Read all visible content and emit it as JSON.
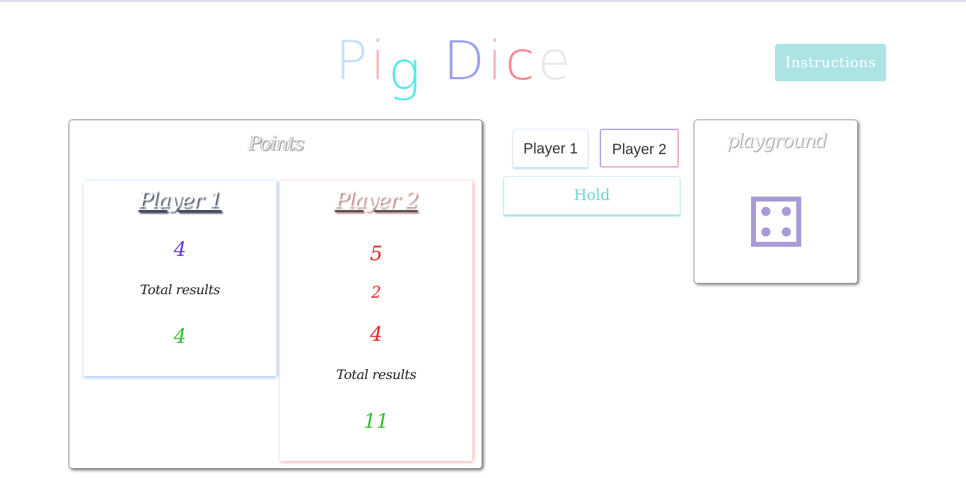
{
  "header": {
    "title_letters": [
      {
        "char": "P",
        "color": "#c6defb"
      },
      {
        "char": "i",
        "color": "#f8b9bf"
      },
      {
        "char": "g",
        "color": "#58e9ea"
      },
      {
        "char": " ",
        "color": "#ffffff"
      },
      {
        "char": "D",
        "color": "#9ba0f1"
      },
      {
        "char": "i",
        "color": "#f8b7bc"
      },
      {
        "char": "c",
        "color": "#f5898e"
      },
      {
        "char": "e",
        "color": "#e5e9ec"
      }
    ],
    "instructions_label": "Instructions"
  },
  "points": {
    "title": "Points",
    "player1": {
      "name": "Player 1",
      "rolls": [
        "4"
      ],
      "roll_color": "#6438e0",
      "total_label": "Total results",
      "total": "4",
      "total_color": "#2ec12e"
    },
    "player2": {
      "name": "Player 2",
      "rolls": [
        "5",
        "2",
        "4"
      ],
      "roll_color": "#e52626",
      "total_label": "Total results",
      "total": "11",
      "total_color": "#2ec12e"
    }
  },
  "controls": {
    "player1_label": "Player 1",
    "player2_label": "Player 2",
    "hold_label": "Hold"
  },
  "playground": {
    "title": "playground",
    "die_value": 4,
    "die_color": "#a99bd7"
  }
}
